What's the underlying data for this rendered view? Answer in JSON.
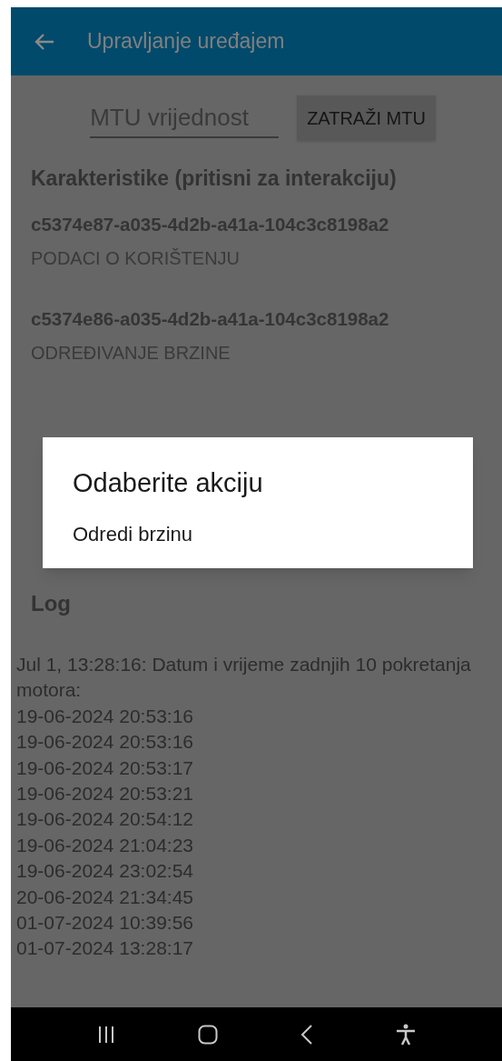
{
  "app_bar": {
    "title": "Upravljanje uređajem"
  },
  "mtu": {
    "placeholder": "MTU vrijednost",
    "button": "ZATRAŽI MTU"
  },
  "characteristics": {
    "heading": "Karakteristike (pritisni za interakciju)",
    "items": [
      {
        "uuid": "c5374e87-a035-4d2b-a41a-104c3c8198a2",
        "name": "PODACI O KORIŠTENJU"
      },
      {
        "uuid": "c5374e86-a035-4d2b-a41a-104c3c8198a2",
        "name": "ODREĐIVANJE BRZINE"
      }
    ]
  },
  "dialog": {
    "title": "Odaberite akciju",
    "options": [
      "Odredi brzinu"
    ]
  },
  "log": {
    "heading": "Log",
    "lines": [
      "Jul 1, 13:28:16: Datum i vrijeme zadnjih 10 pokretanja motora:",
      "19-06-2024 20:53:16",
      "19-06-2024 20:53:16",
      "19-06-2024 20:53:17",
      "19-06-2024 20:53:21",
      "19-06-2024 20:54:12",
      "19-06-2024 21:04:23",
      "19-06-2024 23:02:54",
      "20-06-2024 21:34:45",
      "01-07-2024 10:39:56",
      "01-07-2024 13:28:17"
    ]
  }
}
